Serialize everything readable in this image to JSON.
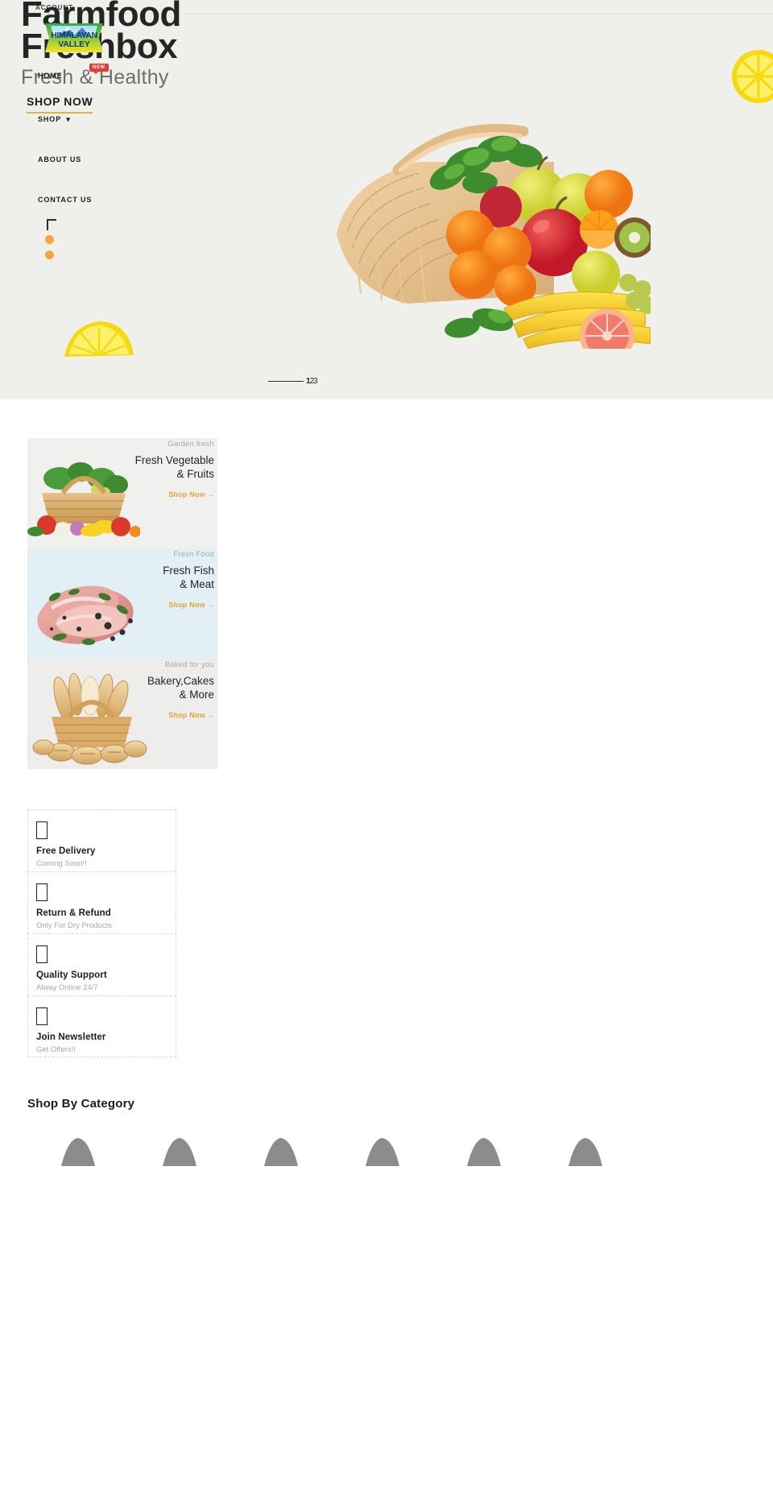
{
  "site": {
    "brand_logo_text_line1": "HIMALAYAN",
    "brand_logo_text_line2": "VALLEY",
    "account_label": "ACCOUNT"
  },
  "hero": {
    "title_line1": "Farmfood",
    "title_line2": "Freshbox",
    "subtitle": "Fresh & Healthy",
    "cta_label": "SHOP NOW",
    "accent_color": "#e8b33d",
    "background_color": "#efefeb"
  },
  "nav": {
    "items": [
      {
        "label": "HOME",
        "badge": "NEW",
        "has_caret": false
      },
      {
        "label": "SHOP",
        "badge": "",
        "has_caret": true
      },
      {
        "label": "ABOUT US",
        "badge": "",
        "has_caret": false
      },
      {
        "label": "CONTACT US",
        "badge": "",
        "has_caret": false
      }
    ]
  },
  "slider": {
    "pages": [
      "1",
      "2",
      "3"
    ],
    "active_page": "1"
  },
  "promos": [
    {
      "eyebrow": "Garden fresh",
      "title_line1": "Fresh Vegetable",
      "title_line2": "& Fruits",
      "cta": "Shop Now",
      "cta_arrow": "→",
      "bg": "#f0f0ee"
    },
    {
      "eyebrow": "Fresh Food",
      "title_line1": "Fresh Fish",
      "title_line2": "& Meat",
      "cta": "Shop Now",
      "cta_arrow": "→",
      "bg": "#e2f0f6"
    },
    {
      "eyebrow": "Baked for you",
      "title_line1": "Bakery,Cakes",
      "title_line2": "& More",
      "cta": "Shop Now",
      "cta_arrow": "→",
      "bg": "#ededeb"
    }
  ],
  "features": [
    {
      "title": "Free Delivery",
      "desc": "Coming Soon!!",
      "icon": "delivery-truck-icon"
    },
    {
      "title": "Return & Refund",
      "desc": "Only For Dry Products",
      "icon": "refund-icon"
    },
    {
      "title": "Quality Support",
      "desc": "Alway Online 24/7",
      "icon": "headset-icon"
    },
    {
      "title": "Join Newsletter",
      "desc": "Get Offers!!",
      "icon": "envelope-icon"
    }
  ],
  "shop_by_category": {
    "heading": "Shop By Category",
    "items": [
      {
        "image_state": "broken"
      },
      {
        "image_state": "broken"
      },
      {
        "image_state": "broken"
      },
      {
        "image_state": "broken"
      },
      {
        "image_state": "broken"
      },
      {
        "image_state": "broken"
      }
    ]
  }
}
